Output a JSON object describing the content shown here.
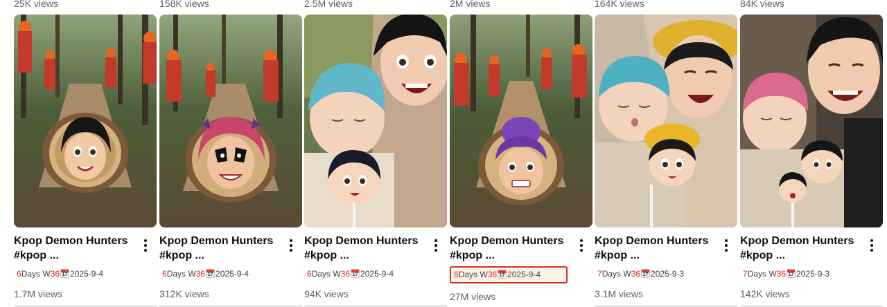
{
  "top_views": [
    "25K views",
    "158K views",
    "2.5M views",
    "2M views",
    "164K views",
    "84K views"
  ],
  "videos": [
    {
      "title_line1": "Kpop Demon Hunters",
      "title_line2": "#kpop ...",
      "meta_a": "6",
      "meta_b": "Days W",
      "meta_c": "36",
      "meta_cal": "17",
      "meta_d": "2025-9-4",
      "views": "1.7M views",
      "thumbnail": "lumberjacks-log-black-hair-girl"
    },
    {
      "title_line1": "Kpop Demon Hunters",
      "title_line2": "#kpop ...",
      "meta_a": "6",
      "meta_b": "Days W",
      "meta_c": "36",
      "meta_cal": "17",
      "meta_d": "2025-9-4",
      "views": "312K views",
      "thumbnail": "lumberjacks-log-pink-hair-girl"
    },
    {
      "title_line1": "Kpop Demon Hunters",
      "title_line2": "#kpop ...",
      "meta_a": "6",
      "meta_b": "Days W",
      "meta_c": "36",
      "meta_cal": "17",
      "meta_d": "2025-9-4",
      "views": "94K views",
      "thumbnail": "mother-blue-hair-child-lollipop"
    },
    {
      "title_line1": "Kpop Demon Hunters",
      "title_line2": "#kpop ...",
      "meta_a": "6",
      "meta_b": "Days W",
      "meta_c": "36",
      "meta_cal": "17",
      "meta_d": "2025-9-4",
      "views": "27M views",
      "thumbnail": "lumberjacks-log-purple-hair-girl",
      "highlighted": true
    },
    {
      "title_line1": "Kpop Demon Hunters",
      "title_line2": "#kpop ...",
      "meta_a": "7",
      "meta_b": "Days W",
      "meta_c": "36",
      "meta_cal": "17",
      "meta_d": "2025-9-3",
      "views": "3.1M views",
      "thumbnail": "mother-yellow-hat-child-lollipop"
    },
    {
      "title_line1": "Kpop Demon Hunters",
      "title_line2": "#kpop ...",
      "meta_a": "7",
      "meta_b": "Days W",
      "meta_c": "36",
      "meta_cal": "17",
      "meta_d": "2025-9-3",
      "views": "142K views",
      "thumbnail": "mother-pink-hair-child-lollipop"
    }
  ],
  "colors": {
    "accent_red": "#e1261c",
    "highlight_border": "#d93025",
    "meta_text": "#404040",
    "views_text": "#606060"
  },
  "icons": {
    "more": "more-vert-icon",
    "calendar": "calendar-icon"
  }
}
